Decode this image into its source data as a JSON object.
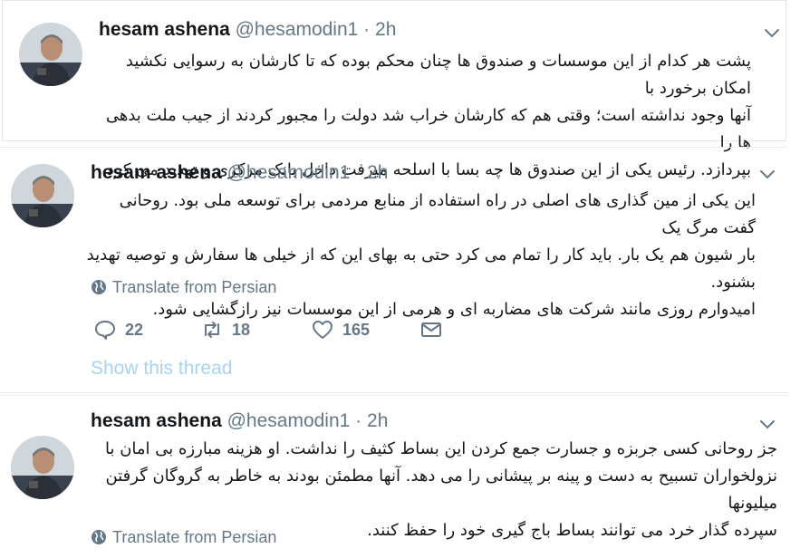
{
  "tweets": [
    {
      "name": "hesam ashena",
      "handle": "@hesamodin1",
      "dot": "·",
      "time": "2h",
      "lines": [
        "پشت هر کدام از این موسسات و صندوق ها چنان محکم بوده که تا کارشان به رسوایی نکشید امکان برخورد با",
        "آنها وجود نداشته است؛ وقتی هم که کارشان خراب شد دولت را مجبور کردند از جیب ملت بدهی ها را",
        "بپردازد. رئیس یکی از این صندوق ها چه بسا با اسلحه میرفت داخل بانک مرکزی و تهدید می کرد."
      ]
    },
    {
      "name": "hesam ashena",
      "handle": "@hesamodin1",
      "dot": "·",
      "time": "2h",
      "lines": [
        "این یکی از مین گذاری های اصلی در راه استفاده از منابع مردمی برای توسعه ملی بود. روحانی گفت مرگ یک",
        "بار شیون هم یک بار. باید کار را تمام می کرد حتی به بهای این که از خیلی ها سفارش و توصیه تهدید بشنود.",
        "امیدوارم روزی مانند شرکت های مضاربه ای و هرمی از این موسسات نیز رازگشایی شود."
      ],
      "translate": "Translate from Persian",
      "replies": "22",
      "retweets": "18",
      "likes": "165",
      "show_thread": "Show this thread"
    },
    {
      "name": "hesam ashena",
      "handle": "@hesamodin1",
      "dot": "·",
      "time": "2h",
      "lines": [
        "جز روحانی کسی جربزه و جسارت جمع کردن این بساط کثیف را نداشت. او هزینه مبارزه بی امان با",
        "نزولخواران تسبیح به دست و پینه بر پیشانی را می دهد. آنها مطمئن بودند به خاطر به گروگان گرفتن میلیونها",
        "سپرده گذار خرد می توانند بساط باج گیری خود را حفظ کنند."
      ],
      "translate": "Translate from Persian"
    }
  ],
  "icons": {
    "reply": "reply-icon",
    "retweet": "retweet-icon",
    "like": "heart-icon",
    "dm": "envelope-icon",
    "globe": "globe-icon",
    "caret": "chevron-down-icon"
  },
  "colors": {
    "text": "#14171a",
    "secondary": "#657786",
    "link_faded": "#a6d3f2",
    "border": "#e6ecf0"
  }
}
